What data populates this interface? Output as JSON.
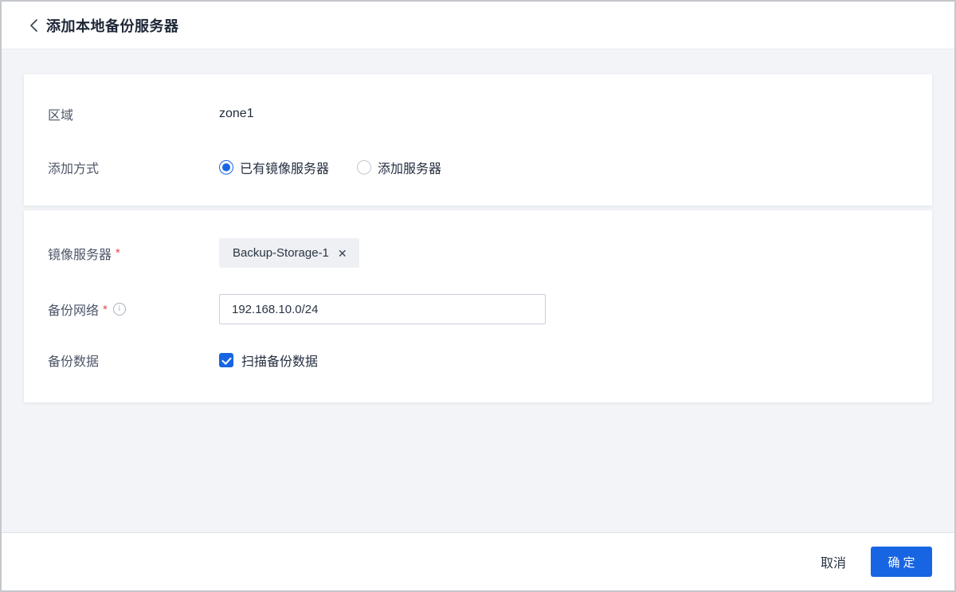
{
  "header": {
    "back_icon": "chevron-left",
    "title": "添加本地备份服务器"
  },
  "form": {
    "zone": {
      "label": "区域",
      "value": "zone1"
    },
    "add_mode": {
      "label": "添加方式",
      "options": [
        {
          "label": "已有镜像服务器",
          "selected": true
        },
        {
          "label": "添加服务器",
          "selected": false
        }
      ]
    },
    "image_server": {
      "label": "镜像服务器",
      "required_mark": "*",
      "tag_text": "Backup-Storage-1",
      "remove_icon": "✕"
    },
    "backup_network": {
      "label": "备份网络",
      "required_mark": "*",
      "info_icon": "i",
      "value": "192.168.10.0/24"
    },
    "backup_data": {
      "label": "备份数据",
      "checkbox_label": "扫描备份数据",
      "checked": true
    }
  },
  "footer": {
    "cancel": "取消",
    "confirm": "确定"
  },
  "colors": {
    "accent": "#1765E2",
    "background_gray": "#F2F4F7",
    "required_red": "#E5494F",
    "label_gray": "#4D5668",
    "text_dark": "#222C3D"
  }
}
